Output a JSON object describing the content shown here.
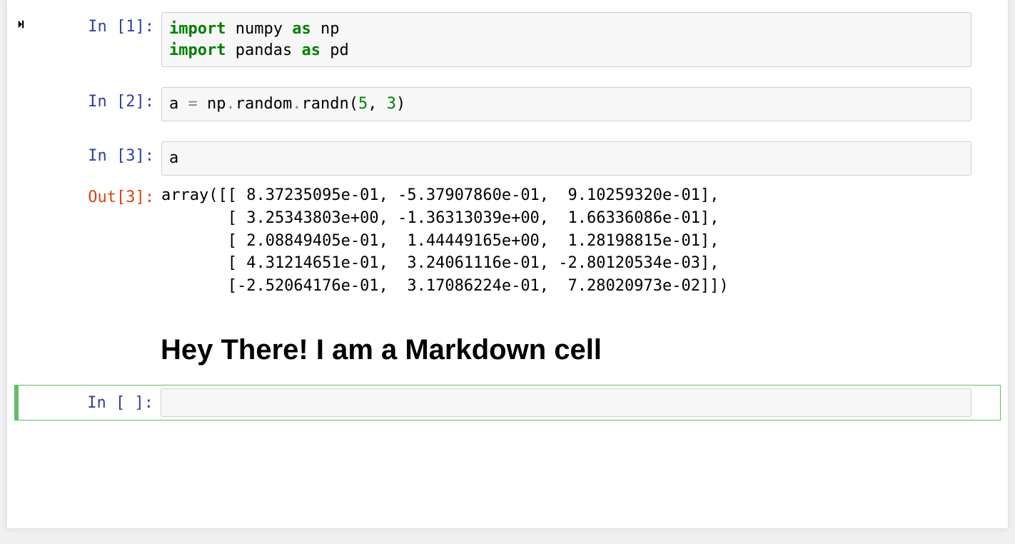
{
  "cells": {
    "c1": {
      "prompt": "In [1]:",
      "code_html": "<span class=\"kw\">import</span> numpy <span class=\"kw\">as</span> np\n<span class=\"kw\">import</span> pandas <span class=\"kw\">as</span> pd"
    },
    "c2": {
      "prompt": "In [2]:",
      "code_html": "a <span class=\"op\">=</span> np<span class=\"op\">.</span>random<span class=\"op\">.</span>randn(<span class=\"num\">5</span>, <span class=\"num\">3</span>)"
    },
    "c3": {
      "prompt": "In [3]:",
      "code_html": "a",
      "out_prompt": "Out[3]:",
      "output": "array([[ 8.37235095e-01, -5.37907860e-01,  9.10259320e-01],\n       [ 3.25343803e+00, -1.36313039e+00,  1.66336086e-01],\n       [ 2.08849405e-01,  1.44449165e+00,  1.28198815e-01],\n       [ 4.31214651e-01,  3.24061116e-01, -2.80120534e-03],\n       [-2.52064176e-01,  3.17086224e-01,  7.28020973e-02]])"
    },
    "md": {
      "heading": "Hey There! I am a Markdown cell"
    },
    "empty": {
      "prompt": "In [ ]:",
      "code_html": ""
    }
  }
}
